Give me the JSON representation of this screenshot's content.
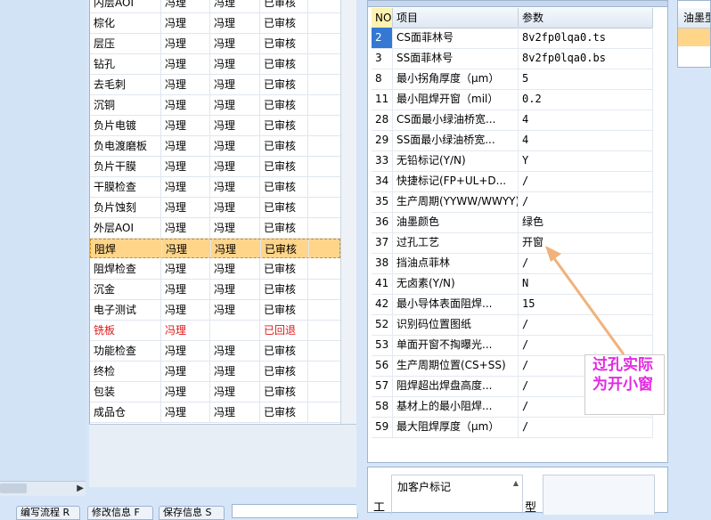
{
  "process_list": {
    "rows": [
      {
        "process": "内层AOI",
        "col2": "冯理",
        "col3": "冯理",
        "status": "已审核"
      },
      {
        "process": "棕化",
        "col2": "冯理",
        "col3": "冯理",
        "status": "已审核"
      },
      {
        "process": "层压",
        "col2": "冯理",
        "col3": "冯理",
        "status": "已审核"
      },
      {
        "process": "钻孔",
        "col2": "冯理",
        "col3": "冯理",
        "status": "已审核"
      },
      {
        "process": "去毛刺",
        "col2": "冯理",
        "col3": "冯理",
        "status": "已审核"
      },
      {
        "process": "沉铜",
        "col2": "冯理",
        "col3": "冯理",
        "status": "已审核"
      },
      {
        "process": "负片电镀",
        "col2": "冯理",
        "col3": "冯理",
        "status": "已审核"
      },
      {
        "process": "负电渡磨板",
        "col2": "冯理",
        "col3": "冯理",
        "status": "已审核"
      },
      {
        "process": "负片干膜",
        "col2": "冯理",
        "col3": "冯理",
        "status": "已审核"
      },
      {
        "process": "干膜检查",
        "col2": "冯理",
        "col3": "冯理",
        "status": "已审核"
      },
      {
        "process": "负片蚀刻",
        "col2": "冯理",
        "col3": "冯理",
        "status": "已审核"
      },
      {
        "process": "外层AOI",
        "col2": "冯理",
        "col3": "冯理",
        "status": "已审核"
      },
      {
        "process": "阻焊",
        "col2": "冯理",
        "col3": "冯理",
        "status": "已审核"
      },
      {
        "process": "阻焊检查",
        "col2": "冯理",
        "col3": "冯理",
        "status": "已审核"
      },
      {
        "process": "沉金",
        "col2": "冯理",
        "col3": "冯理",
        "status": "已审核"
      },
      {
        "process": "电子测试",
        "col2": "冯理",
        "col3": "冯理",
        "status": "已审核"
      },
      {
        "process": "铣板",
        "col2": "冯理",
        "col3": "",
        "status": "已回退"
      },
      {
        "process": "功能检查",
        "col2": "冯理",
        "col3": "冯理",
        "status": "已审核"
      },
      {
        "process": "终检",
        "col2": "冯理",
        "col3": "冯理",
        "status": "已审核"
      },
      {
        "process": "包装",
        "col2": "冯理",
        "col3": "冯理",
        "status": "已审核"
      },
      {
        "process": "成品仓",
        "col2": "冯理",
        "col3": "冯理",
        "status": "已审核"
      }
    ],
    "selected_index": 12,
    "returned_index": 16
  },
  "bottom_tabs": [
    "编写流程 R",
    "修改信息 F",
    "保存信息 S"
  ],
  "params": {
    "headers": {
      "no": "NO",
      "item": "项目",
      "value": "参数"
    },
    "rows": [
      {
        "no": "2",
        "item": "CS面菲林号",
        "value": "8v2fp0lqa0.ts"
      },
      {
        "no": "3",
        "item": "SS面菲林号",
        "value": "8v2fp0lqa0.bs"
      },
      {
        "no": "8",
        "item": "最小拐角厚度（μm）",
        "value": "5"
      },
      {
        "no": "11",
        "item": "最小阻焊开窗（mil）",
        "value": "0.2"
      },
      {
        "no": "28",
        "item": "CS面最小绿油桥宽...",
        "value": "4"
      },
      {
        "no": "29",
        "item": "SS面最小绿油桥宽...",
        "value": "4"
      },
      {
        "no": "33",
        "item": "无铅标记(Y/N)",
        "value": "Y"
      },
      {
        "no": "34",
        "item": "快捷标记(FP+UL+D...",
        "value": "/"
      },
      {
        "no": "35",
        "item": "生产周期(YYWW/WWYY)",
        "value": "/"
      },
      {
        "no": "36",
        "item": "油墨颜色",
        "value": "绿色"
      },
      {
        "no": "37",
        "item": "过孔工艺",
        "value": "开窗"
      },
      {
        "no": "38",
        "item": "挡油点菲林",
        "value": "/"
      },
      {
        "no": "41",
        "item": "无卤素(Y/N)",
        "value": "N"
      },
      {
        "no": "42",
        "item": "最小导体表面阻焊...",
        "value": "15"
      },
      {
        "no": "52",
        "item": "识别码位置图纸",
        "value": "/"
      },
      {
        "no": "53",
        "item": "单面开窗不掏曝光...",
        "value": "/"
      },
      {
        "no": "56",
        "item": "生产周期位置(CS+SS)",
        "value": "/"
      },
      {
        "no": "57",
        "item": "阻焊超出焊盘高度...",
        "value": "/"
      },
      {
        "no": "58",
        "item": "基材上的最小阻焊...",
        "value": "/"
      },
      {
        "no": "59",
        "item": "最大阻焊厚度（μm）",
        "value": "/"
      }
    ],
    "active_index": 0
  },
  "sub_panel": {
    "gong_label": "工",
    "customer_mark_label": "加客户标记",
    "xing_label": "型"
  },
  "far_right": {
    "header": "油墨型"
  },
  "annotation": {
    "line1": "过孔实际",
    "line2": "为开小窗",
    "color": "#e22ae2"
  }
}
